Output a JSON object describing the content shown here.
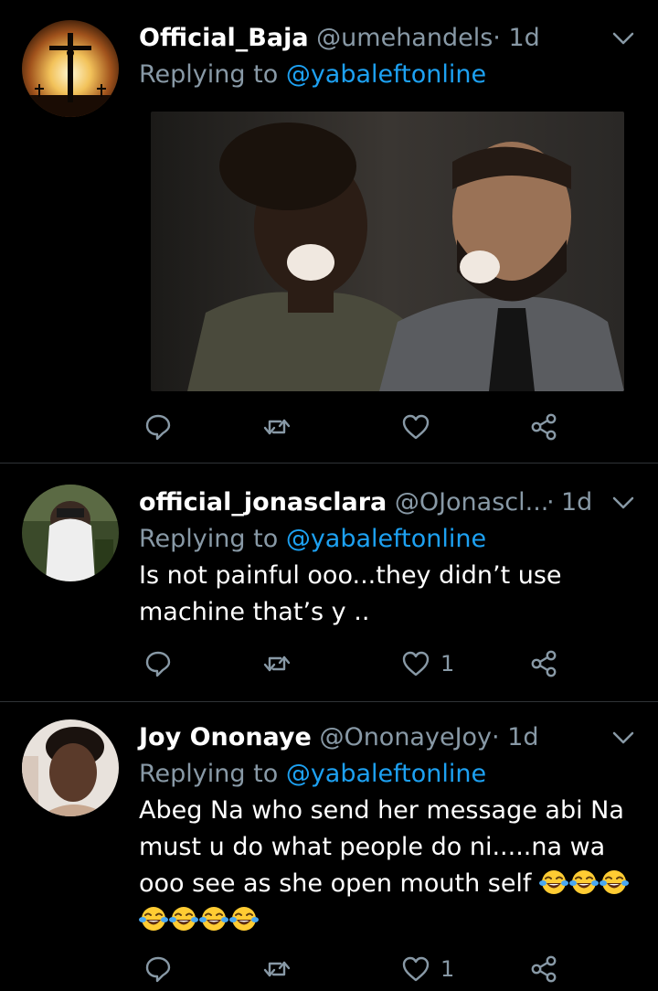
{
  "tweets": [
    {
      "display_name": "Official_Baja",
      "handle": "@umehandels",
      "separator": "·",
      "time": "1d",
      "replying_prefix": "Replying to ",
      "replying_to": "@yabaleftonline",
      "text": "",
      "has_media": true,
      "avatar_icon": "crucifix-sunset-avatar",
      "like_count": "",
      "emoji_count": 0
    },
    {
      "display_name": "official_jonasclara",
      "handle": "@OJonascl...",
      "separator": "·",
      "time": "1d",
      "replying_prefix": "Replying to ",
      "replying_to": "@yabaleftonline",
      "text": "Is not painful ooo...they didn’t use machine that’s y ..",
      "has_media": false,
      "avatar_icon": "person-face-covered-avatar",
      "like_count": "1",
      "emoji_count": 0
    },
    {
      "display_name": "Joy Ononaye",
      "handle": "@OnonayeJoy",
      "separator": "·",
      "time": "1d",
      "replying_prefix": "Replying to ",
      "replying_to": "@yabaleftonline",
      "text": "Abeg Na who send her message abi Na must u do what people do ni.....na wa ooo  see as she open mouth self ",
      "has_media": false,
      "avatar_icon": "person-selfie-avatar",
      "like_count": "1",
      "emoji_count": 7
    }
  ],
  "icons": {
    "reply": "reply-icon",
    "retweet": "retweet-icon",
    "like": "heart-icon",
    "share": "share-icon",
    "menu": "chevron-down-icon",
    "emoji": "tears-of-joy-emoji"
  },
  "colors": {
    "background": "#000000",
    "text": "#ffffff",
    "secondary": "#8899a6",
    "link": "#1da1f2",
    "divider": "#2f3336"
  }
}
